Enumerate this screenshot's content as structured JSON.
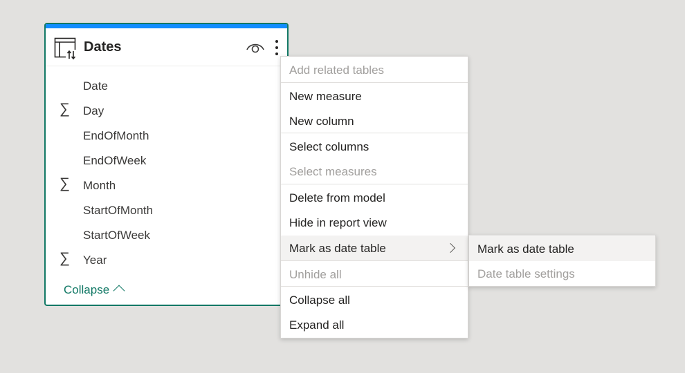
{
  "table_card": {
    "title": "Dates",
    "fields": [
      {
        "label": "Date",
        "sigma": ""
      },
      {
        "label": "Day",
        "sigma": "∑"
      },
      {
        "label": "EndOfMonth",
        "sigma": ""
      },
      {
        "label": "EndOfWeek",
        "sigma": ""
      },
      {
        "label": "Month",
        "sigma": "∑"
      },
      {
        "label": "StartOfMonth",
        "sigma": ""
      },
      {
        "label": "StartOfWeek",
        "sigma": ""
      },
      {
        "label": "Year",
        "sigma": "∑"
      }
    ],
    "collapse_label": "Collapse",
    "icons": [
      "table-icon",
      "eye-icon",
      "more-options-icon",
      "chevron-up-icon"
    ]
  },
  "context_menu": {
    "items": [
      {
        "label": "Add related tables",
        "disabled": true
      },
      {
        "label": "New measure",
        "disabled": false
      },
      {
        "label": "New column",
        "disabled": false
      },
      {
        "label": "Select columns",
        "disabled": false
      },
      {
        "label": "Select measures",
        "disabled": true
      },
      {
        "label": "Delete from model",
        "disabled": false
      },
      {
        "label": "Hide in report view",
        "disabled": false
      },
      {
        "label": "Mark as date table",
        "disabled": false,
        "has_submenu": true,
        "active": true
      },
      {
        "label": "Unhide all",
        "disabled": true
      },
      {
        "label": "Collapse all",
        "disabled": false
      },
      {
        "label": "Expand all",
        "disabled": false
      }
    ]
  },
  "submenu": {
    "items": [
      {
        "label": "Mark as date table",
        "disabled": false,
        "active": true
      },
      {
        "label": "Date table settings",
        "disabled": true
      }
    ]
  },
  "colors": {
    "background": "#e2e1df",
    "card_border": "#117865",
    "card_topbar": "#118dff",
    "link": "#117865",
    "disabled_text": "#a19f9d"
  }
}
